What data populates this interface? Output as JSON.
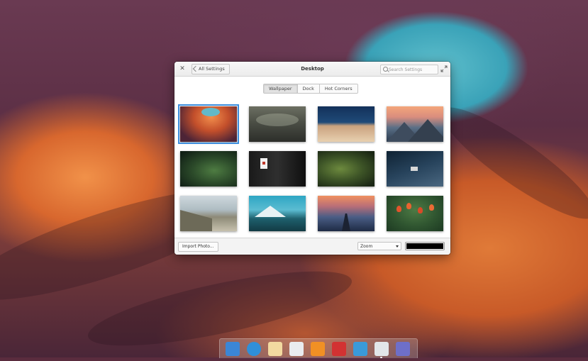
{
  "window": {
    "title": "Desktop",
    "back_label": "All Settings",
    "search_placeholder": "Search Settings"
  },
  "tabs": [
    {
      "label": "Wallpaper",
      "active": true
    },
    {
      "label": "Dock",
      "active": false
    },
    {
      "label": "Hot Corners",
      "active": false
    }
  ],
  "wallpapers": [
    {
      "name": "canyon",
      "selected": true
    },
    {
      "name": "misty-mountain",
      "selected": false
    },
    {
      "name": "ocean-dock",
      "selected": false
    },
    {
      "name": "mountain-sunset",
      "selected": false
    },
    {
      "name": "fern-leaf",
      "selected": false
    },
    {
      "name": "sign-on-door",
      "selected": false
    },
    {
      "name": "green-leaves",
      "selected": false
    },
    {
      "name": "boat-at-night",
      "selected": false
    },
    {
      "name": "beach-cliff",
      "selected": false
    },
    {
      "name": "snowy-mountain-lake",
      "selected": false
    },
    {
      "name": "pier-sunset",
      "selected": false
    },
    {
      "name": "red-tulips",
      "selected": false
    }
  ],
  "footer": {
    "import_label": "Import Photo...",
    "zoom_value": "Zoom",
    "background_color": "#000000"
  },
  "dock": [
    {
      "name": "multitasking-view-icon",
      "color": "#3b86d6"
    },
    {
      "name": "web-browser-icon",
      "color": "#2f8fd8"
    },
    {
      "name": "mail-icon",
      "color": "#f2d9a0"
    },
    {
      "name": "calendar-icon",
      "color": "#e9ecef"
    },
    {
      "name": "music-icon",
      "color": "#f19024"
    },
    {
      "name": "videos-icon",
      "color": "#d23232"
    },
    {
      "name": "photos-icon",
      "color": "#3a9ad9"
    },
    {
      "name": "switchboard-icon",
      "color": "#e2e6ea"
    },
    {
      "name": "appcenter-icon",
      "color": "#6e6fc9"
    }
  ]
}
